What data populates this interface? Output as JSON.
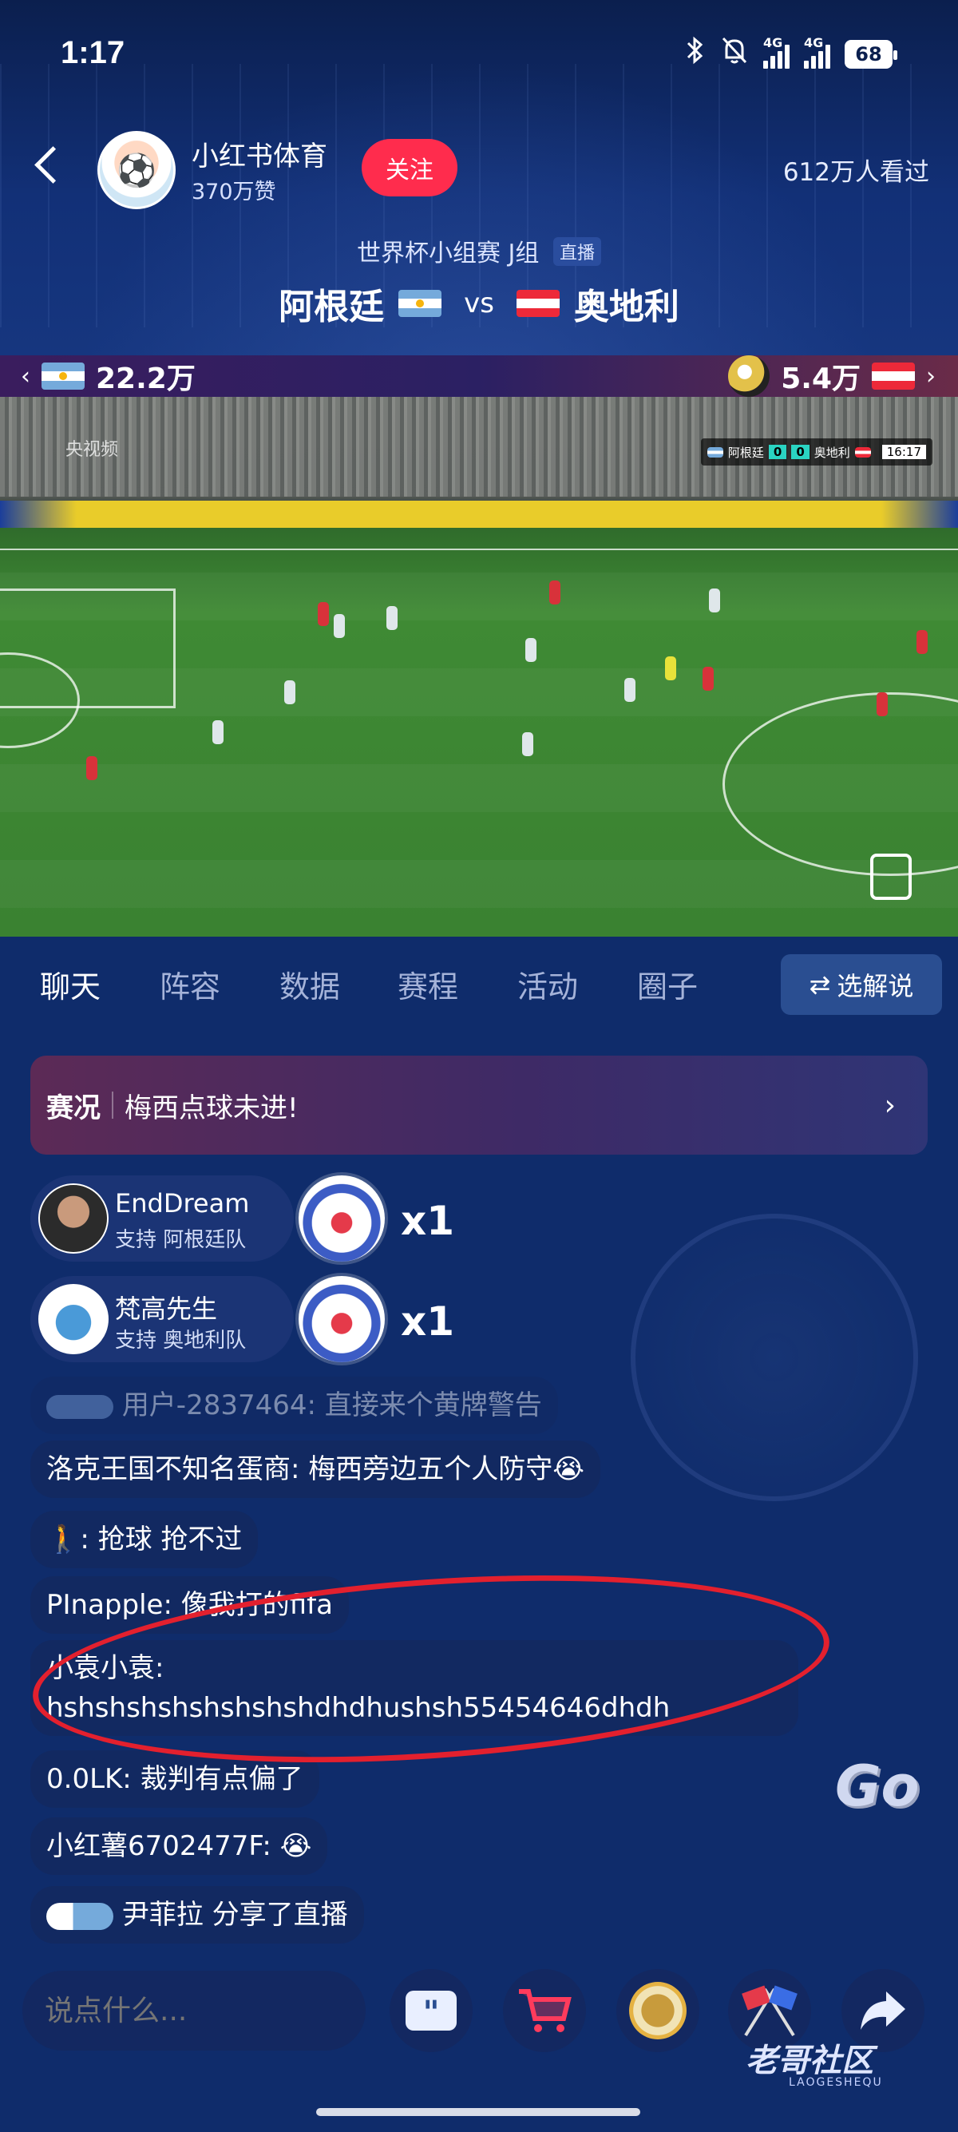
{
  "status_bar": {
    "time": "1:17",
    "net1": "4G",
    "net2": "4G",
    "battery": "68"
  },
  "header": {
    "channel_name": "小红书体育",
    "likes": "370万赞",
    "follow_label": "关注",
    "viewers": "612万人看过"
  },
  "match": {
    "subtitle": "世界杯小组赛 J组",
    "live_tag": "直播",
    "home_team": "阿根廷",
    "vs": "vs",
    "away_team": "奥地利"
  },
  "support": {
    "home_count": "22.2万",
    "away_count": "5.4万"
  },
  "video": {
    "watermark": "央视频",
    "scorebug": {
      "home": "阿根廷",
      "home_score": "0",
      "away_score": "0",
      "away": "奥地利",
      "clock": "16:17"
    }
  },
  "tabs": [
    {
      "label": "聊天",
      "active": true
    },
    {
      "label": "阵容"
    },
    {
      "label": "数据"
    },
    {
      "label": "赛程"
    },
    {
      "label": "活动"
    },
    {
      "label": "圈子"
    }
  ],
  "commentary_button": "选解说",
  "event": {
    "label": "赛况",
    "text": "梅西点球未进!"
  },
  "gifts": [
    {
      "name": "EndDream",
      "team": "支持 阿根廷队",
      "count": "x1"
    },
    {
      "name": "梵高先生",
      "team": "支持 奥地利队",
      "count": "x1"
    }
  ],
  "messages": [
    {
      "name": "用户-2837464:",
      "text": "直接来个黄牌警告"
    },
    {
      "name": "洛克王国不知名蛋商:",
      "text": "梅西旁边五个人防守😭"
    },
    {
      "name": ":",
      "text": "抢球 抢不过"
    },
    {
      "name": "PInapple:",
      "text": "像我打的fifa"
    },
    {
      "name": "小袁小袁:",
      "text": "hshshshshshshshshdhdhushsh55454646dhdh"
    },
    {
      "name": "0.0LK:",
      "text": "裁判有点偏了"
    },
    {
      "name": "小红薯6702477F:",
      "text": "😭"
    },
    {
      "name": "尹菲拉",
      "text": "分享了直播"
    }
  ],
  "input_placeholder": "说点什么...",
  "go_badge": "Go",
  "brand": {
    "name": "老哥社区",
    "sub": "LAOGESHEQU"
  },
  "colors": {
    "accent": "#ff2c4d",
    "background": "#0f2c6b",
    "circle": "#e3202e"
  }
}
